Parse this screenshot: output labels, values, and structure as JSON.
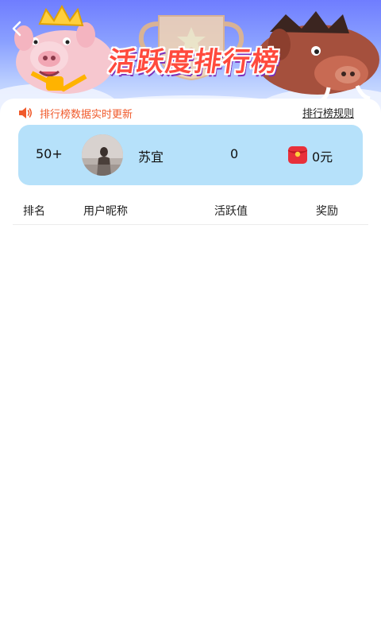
{
  "header": {
    "title": "活跃度排行榜",
    "back_icon": "chevron-left-icon"
  },
  "notice": {
    "icon": "speaker-icon",
    "text": "排行榜数据实时更新",
    "rules_link": "排行榜规则"
  },
  "my_rank": {
    "rank": "50+",
    "avatar": "avatar",
    "name": "苏宜",
    "activity": "0",
    "reward_icon": "red-packet-icon",
    "reward": "0元"
  },
  "table": {
    "columns": [
      "排名",
      "用户昵称",
      "活跃值",
      "奖励"
    ],
    "rows": []
  },
  "colors": {
    "accent": "#f05a2b",
    "card_bg": "#b6e1fa",
    "title_red": "#ff4a3d",
    "banner_top": "#6f7dff"
  }
}
